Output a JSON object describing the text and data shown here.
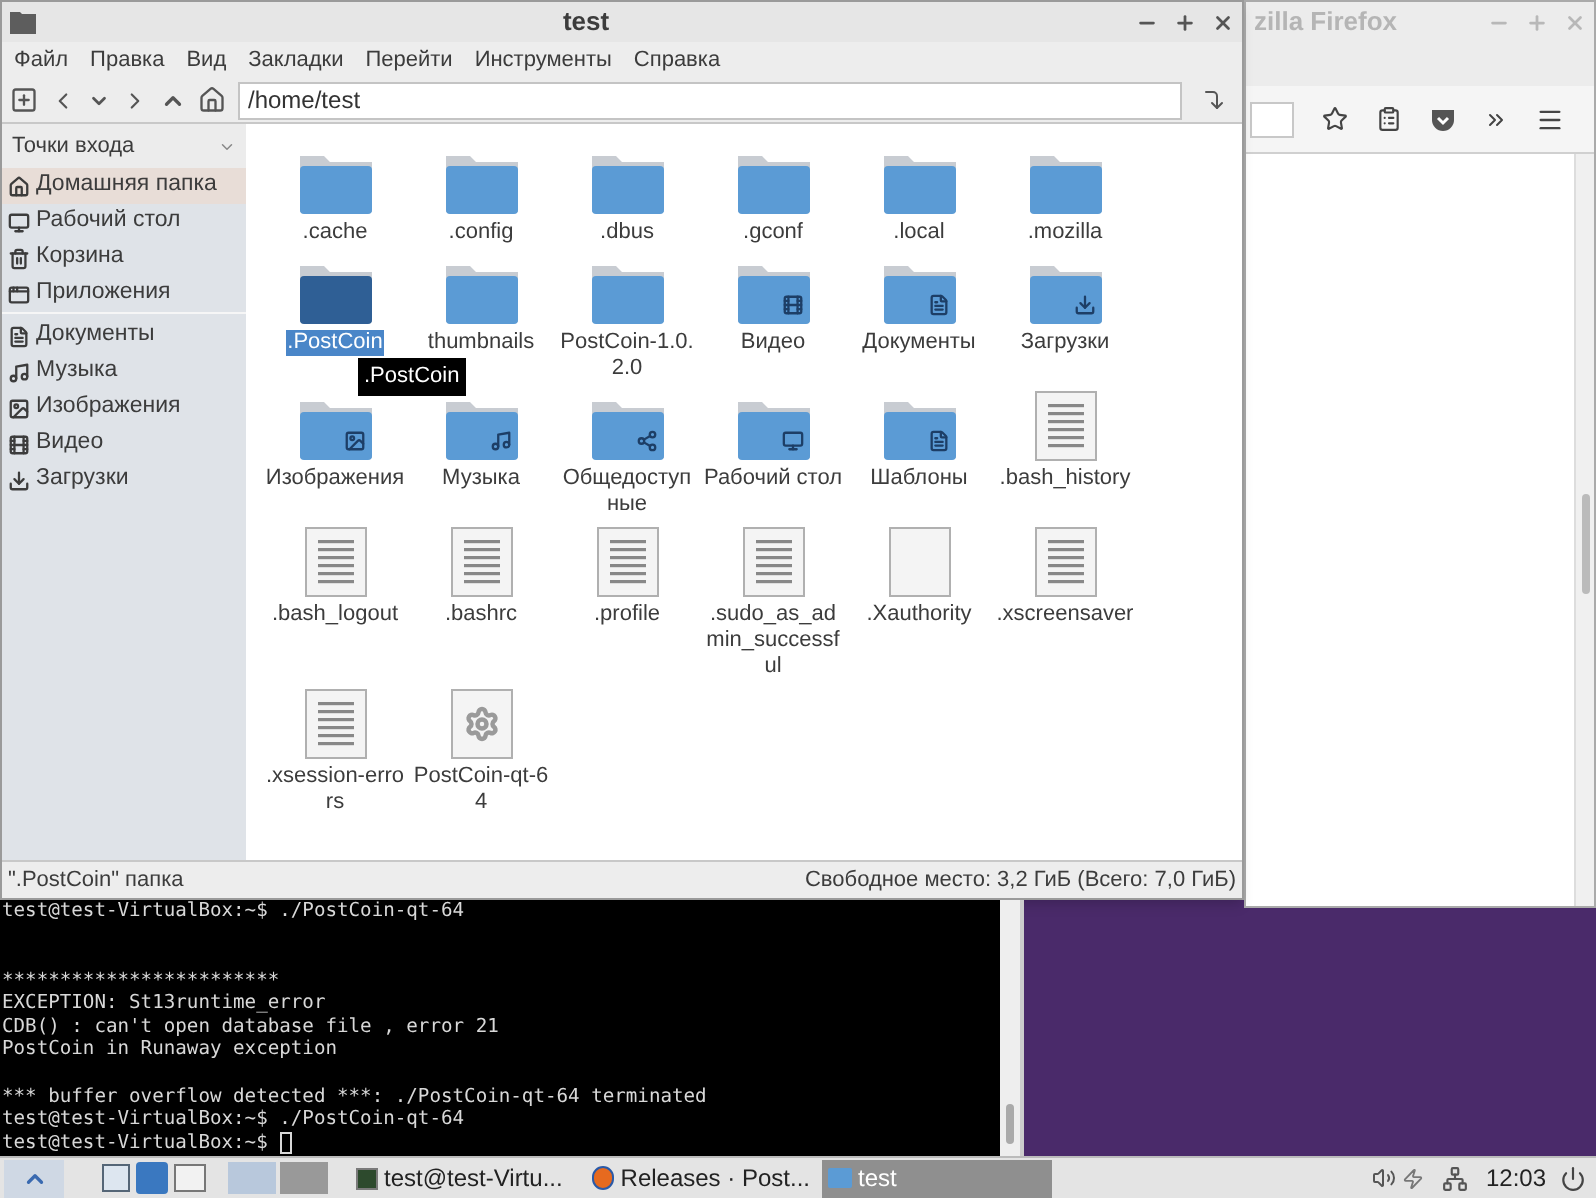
{
  "file_manager": {
    "title": "test",
    "menu": [
      "Файл",
      "Правка",
      "Вид",
      "Закладки",
      "Перейти",
      "Инструменты",
      "Справка"
    ],
    "path": "/home/test",
    "sidebar": {
      "header": "Точки входа",
      "groups": [
        [
          {
            "label": "Домашняя папка",
            "kind": "home",
            "selected": true
          },
          {
            "label": "Рабочий стол",
            "kind": "desktop",
            "selected": false
          },
          {
            "label": "Корзина",
            "kind": "trash",
            "selected": false
          },
          {
            "label": "Приложения",
            "kind": "apps",
            "selected": false
          }
        ],
        [
          {
            "label": "Документы",
            "kind": "documents",
            "selected": false
          },
          {
            "label": "Музыка",
            "kind": "music",
            "selected": false
          },
          {
            "label": "Изображения",
            "kind": "pictures",
            "selected": false
          },
          {
            "label": "Видео",
            "kind": "video",
            "selected": false
          },
          {
            "label": "Загрузки",
            "kind": "downloads",
            "selected": false
          }
        ]
      ]
    },
    "items": [
      {
        "name": ".cache",
        "kind": "folder",
        "selected": false
      },
      {
        "name": ".config",
        "kind": "folder",
        "selected": false
      },
      {
        "name": ".dbus",
        "kind": "folder",
        "selected": false
      },
      {
        "name": ".gconf",
        "kind": "folder",
        "selected": false
      },
      {
        "name": ".local",
        "kind": "folder",
        "selected": false
      },
      {
        "name": ".mozilla",
        "kind": "folder",
        "selected": false
      },
      {
        "name": ".PostCoin",
        "kind": "folder",
        "selected": true,
        "tooltip": ".PostCoin"
      },
      {
        "name": "thumbnails",
        "kind": "folder",
        "selected": false
      },
      {
        "name": "PostCoin-1.0.2.0",
        "kind": "folder",
        "selected": false
      },
      {
        "name": "Видео",
        "kind": "videofolder",
        "selected": false
      },
      {
        "name": "Документы",
        "kind": "documentsfolder",
        "selected": false
      },
      {
        "name": "Загрузки",
        "kind": "downloadsfolder",
        "selected": false
      },
      {
        "name": "Изображения",
        "kind": "picturesfolder",
        "selected": false
      },
      {
        "name": "Музыка",
        "kind": "musicfolder",
        "selected": false
      },
      {
        "name": "Общедоступные",
        "kind": "sharefolder",
        "selected": false
      },
      {
        "name": "Рабочий стол",
        "kind": "desktopfolder",
        "selected": false
      },
      {
        "name": "Шаблоны",
        "kind": "templatesfolder",
        "selected": false
      },
      {
        "name": ".bash_history",
        "kind": "textfile",
        "selected": false
      },
      {
        "name": ".bash_logout",
        "kind": "textfile",
        "selected": false
      },
      {
        "name": ".bashrc",
        "kind": "textfile",
        "selected": false
      },
      {
        "name": ".profile",
        "kind": "textfile",
        "selected": false
      },
      {
        "name": ".sudo_as_admin_successful",
        "kind": "textfile",
        "selected": false
      },
      {
        "name": ".Xauthority",
        "kind": "blankfile",
        "selected": false
      },
      {
        "name": ".xscreensaver",
        "kind": "textfile",
        "selected": false
      },
      {
        "name": ".xsession-errors",
        "kind": "textfile",
        "selected": false
      },
      {
        "name": "PostCoin-qt-64",
        "kind": "executable",
        "selected": false
      }
    ],
    "status_left": "\".PostCoin\" папка",
    "status_right": "Свободное место: 3,2 ГиБ (Всего: 7,0 ГиБ)"
  },
  "browser": {
    "title": "zilla Firefox"
  },
  "terminal": {
    "groups": [
      [
        "test@test-VirtualBox:~$ ./PostCoin-qt-64"
      ],
      [
        "************************",
        "EXCEPTION: St13runtime_error",
        "CDB() : can't open database file , error 21",
        "PostCoin in Runaway exception"
      ],
      [
        "*** buffer overflow detected ***: ./PostCoin-qt-64 terminated",
        "test@test-VirtualBox:~$ ./PostCoin-qt-64",
        "test@test-VirtualBox:~$ "
      ]
    ]
  },
  "taskbar": {
    "tasks": [
      {
        "label": "test@test-Virtu...",
        "kind": "terminal",
        "selected": false
      },
      {
        "label": "Releases · Post...",
        "kind": "browser",
        "selected": false
      },
      {
        "label": "test",
        "kind": "folder",
        "selected": true
      }
    ],
    "clock": "12:03"
  }
}
